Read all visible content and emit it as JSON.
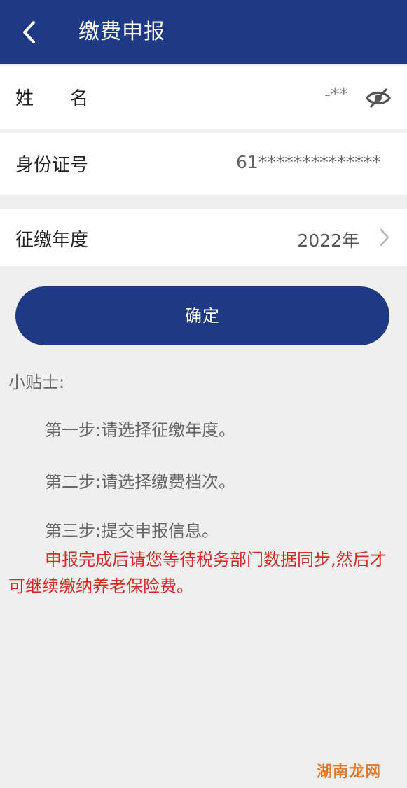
{
  "header": {
    "title": "缴费申报",
    "back_icon": "chevron-left-icon"
  },
  "form": {
    "name": {
      "label_first": "姓",
      "label_second": "名",
      "value": "-**",
      "toggle_icon": "eye-off-icon"
    },
    "id_number": {
      "label": "身份证号",
      "value": "61**************"
    },
    "year": {
      "label": "征缴年度",
      "value": "2022年",
      "chevron_icon": "chevron-right-icon"
    }
  },
  "confirm_button": {
    "label": "确定"
  },
  "tips": {
    "title": "小贴士:",
    "steps": [
      "第一步:请选择征缴年度。",
      "第二步:请选择缴费档次。",
      "第三步:提交申报信息。"
    ],
    "notice": "申报完成后请您等待税务部门数据同步,然后才可继续缴纳养老保险费。"
  },
  "watermark": "湖南龙网",
  "colors": {
    "primary": "#1e3a84",
    "background": "#efeff0",
    "notice": "#d42a24"
  }
}
